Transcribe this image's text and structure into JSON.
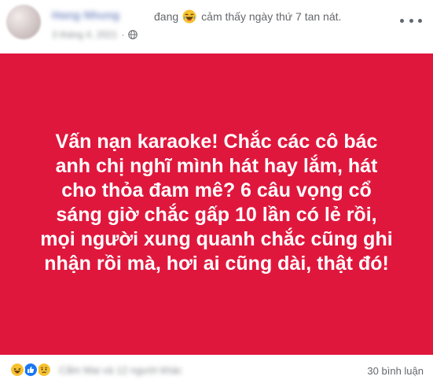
{
  "header": {
    "author_name": "Hang Nhung",
    "status_verb": "đang",
    "feeling_icon": "laughing-emoji-icon",
    "feeling_text": "cảm thấy ngày thứ 7 tan nát.",
    "timestamp": "3 tháng 4, 2021",
    "privacy_icon": "globe-icon",
    "more_icon": "more-options-icon"
  },
  "post": {
    "background_color": "#e0173d",
    "text": "Vấn nạn karaoke! Chắc các cô bác\nanh chị nghĩ mình hát hay lắm, hát\ncho thỏa đam mê? 6 câu vọng cổ\nsáng giờ chắc gấp 10 lần có lẻ rồi,\nmọi người xung quanh chắc cũng ghi\nnhận rồi mà, hơi ai cũng dài, thật đó!"
  },
  "footer": {
    "reaction_icons": [
      "haha-reaction-icon",
      "like-reaction-icon",
      "sad-reaction-icon"
    ],
    "reaction_names": "Cẩm Mai và 12 người khác",
    "comments_label": "30 bình luận"
  }
}
